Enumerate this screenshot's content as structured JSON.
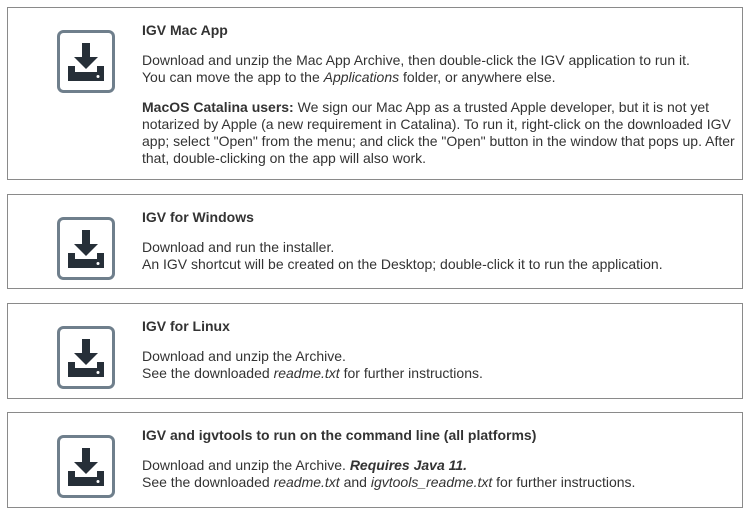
{
  "colors": {
    "icon_fill": "#262f38",
    "icon_border": "#6f7f8c",
    "card_border": "#8a8a8a",
    "text": "#333333"
  },
  "icons": {
    "download": "download-tray-icon"
  },
  "mac": {
    "title": "IGV Mac App",
    "p1_line1": "Download and unzip the Mac App Archive, then double-click the IGV application to run it.",
    "p1_line2_a": "You can move the app to the ",
    "p1_line2_em": "Applications",
    "p1_line2_b": " folder, or anywhere else.",
    "catalina_label": "MacOS Catalina users:",
    "catalina_text": " We sign our Mac App as a trusted Apple developer, but it is not yet notarized by Apple (a new requirement in Catalina). To run it, right-click on the downloaded IGV app; select \"Open\" from the menu; and click the \"Open\" button in the window that pops up. After that, double-clicking on the app will also work."
  },
  "windows": {
    "title": "IGV for Windows",
    "line1": "Download and run the installer.",
    "line2": "An IGV shortcut will be created on the Desktop; double-click it to run the application."
  },
  "linux": {
    "title": "IGV for Linux",
    "line1": "Download and unzip the Archive.",
    "line2_a": "See the downloaded ",
    "line2_em": "readme.txt",
    "line2_b": " for further instructions."
  },
  "cli": {
    "title": "IGV and igvtools to run on the command line (all platforms)",
    "line1_a": "Download and unzip the Archive. ",
    "line1_strong": "Requires Java 11.",
    "line2_a": "See the downloaded ",
    "line2_em1": "readme.txt",
    "line2_mid": " and ",
    "line2_em2": "igvtools_readme.txt",
    "line2_b": " for further instructions."
  }
}
